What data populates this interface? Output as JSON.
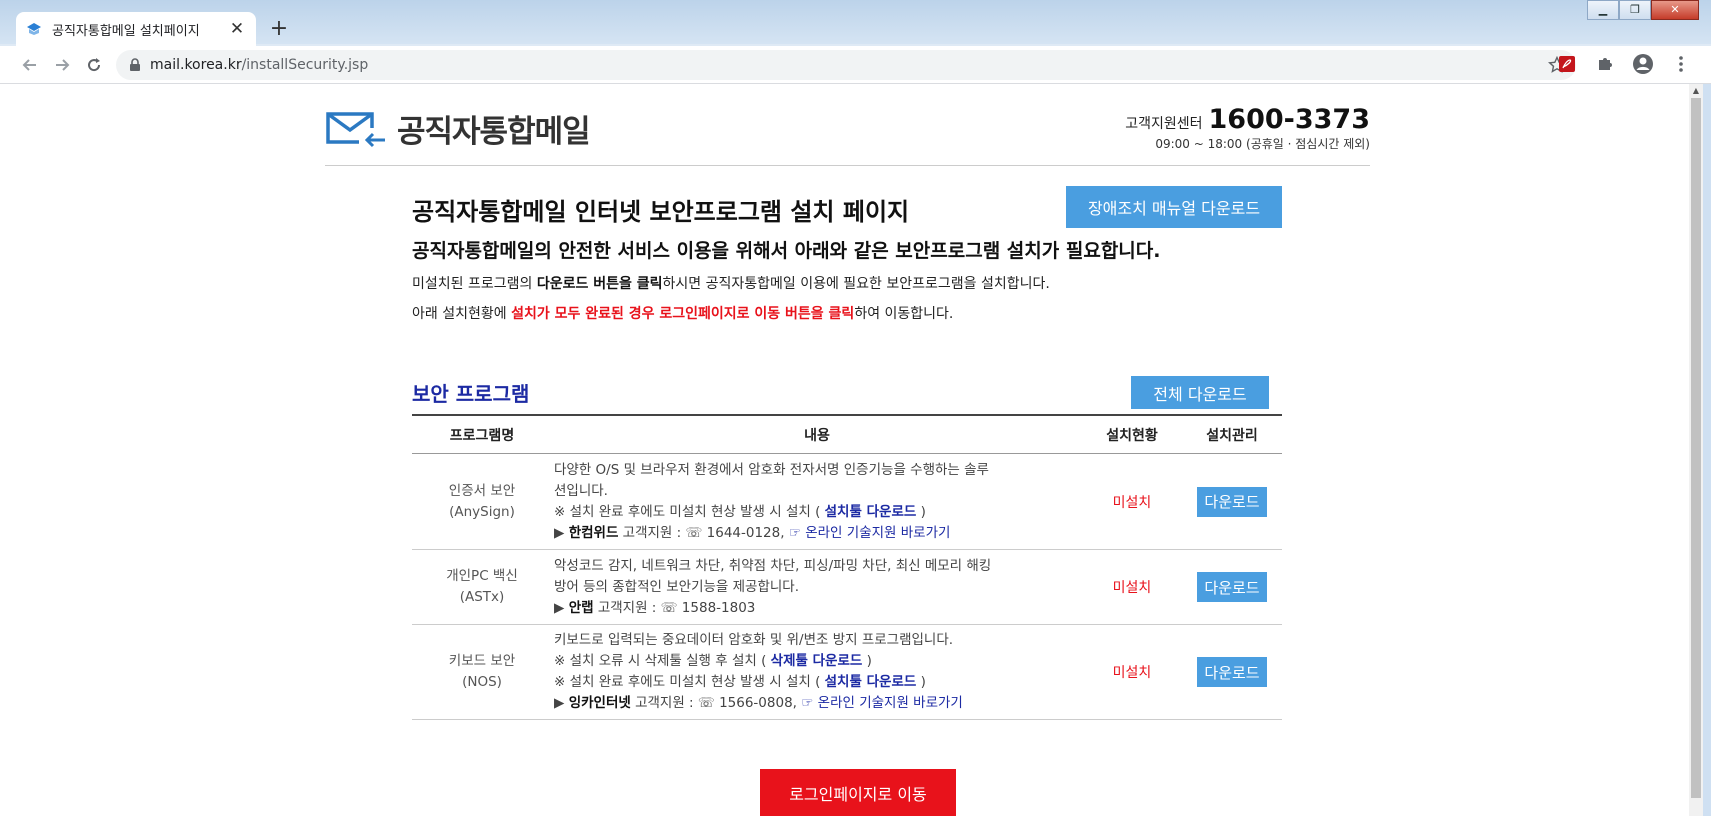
{
  "browser": {
    "tab_title": "공직자통합메일 설치페이지",
    "url_host": "mail.korea.kr",
    "url_path": "/installSecurity.jsp"
  },
  "header": {
    "logo_text": "공직자통합메일",
    "support_label": "고객지원센터",
    "support_phone": "1600-3373",
    "support_hours": "09:00 ~ 18:00 (공휴일 · 점심시간 제외)"
  },
  "intro": {
    "title": "공직자통합메일 인터넷 보안프로그램 설치 페이지",
    "manual_button": "장애조치 매뉴얼 다운로드",
    "subtitle": "공직자통합메일의 안전한 서비스 이용을 위해서 아래와 같은 보안프로그램 설치가 필요합니다.",
    "line1_a": "미설치된 프로그램의 ",
    "line1_b": "다운로드 버튼을 클릭",
    "line1_c": "하시면 공직자통합메일 이용에 필요한 보안프로그램을 설치합니다.",
    "line2_a": "아래 설치현황에 ",
    "line2_b": "설치가 모두 완료된 경우 로그인페이지로 이동 버튼을 클릭",
    "line2_c": "하여 이동합니다."
  },
  "security": {
    "title": "보안 프로그램",
    "all_download_button": "전체 다운로드",
    "headers": [
      "프로그램명",
      "내용",
      "설치현황",
      "설치관리"
    ],
    "rows": [
      {
        "name": "인증서 보안",
        "code": "(AnySign)",
        "desc1": "다양한 O/S 및 브라우저 환경에서 암호화 전자서명 인증기능을 수행하는 솔루",
        "desc2": "션입니다.",
        "note_a": "※ 설치 완료 후에도 미설치 현상 발생 시 설치 ( ",
        "note_link": "설치툴 다운로드",
        "note_b": " )",
        "vendor_prefix": "▶ ",
        "vendor": "한컴위드",
        "vendor_support": " 고객지원 : ☏ 1644-0128, ",
        "online_link": "☞ 온라인 기술지원 바로가기",
        "status": "미설치",
        "button": "다운로드"
      },
      {
        "name": "개인PC 백신",
        "code": "(ASTx)",
        "desc1": "악성코드 감지, 네트워크 차단, 취약점 차단, 피싱/파밍 차단, 최신 메모리 해킹",
        "desc2": "방어 등의 종합적인 보안기능을 제공합니다.",
        "vendor_prefix": "▶ ",
        "vendor": "안랩",
        "vendor_support": " 고객지원 : ☏ 1588-1803",
        "status": "미설치",
        "button": "다운로드"
      },
      {
        "name": "키보드 보안",
        "code": "(NOS)",
        "desc1": "키보드로 입력되는 중요데이터 암호화 및 위/변조 방지 프로그램입니다.",
        "note1_a": "※ 설치 오류 시 삭제툴 실행 후 설치 ( ",
        "note1_link": "삭제툴 다운로드",
        "note1_b": " )",
        "note2_a": "※ 설치 완료 후에도 미설치 현상 발생 시 설치 ( ",
        "note2_link": "설치툴 다운로드",
        "note2_b": " )",
        "vendor_prefix": "▶ ",
        "vendor": "잉카인터넷",
        "vendor_support": " 고객지원 : ☏ 1566-0808, ",
        "online_link": "☞ 온라인 기술지원 바로가기",
        "status": "미설치",
        "button": "다운로드"
      }
    ]
  },
  "login_button": "로그인페이지로 이동",
  "colors": {
    "accent_blue": "#4a9ee0",
    "title_navy": "#1c2aa3",
    "alert_red": "#e8121b"
  }
}
